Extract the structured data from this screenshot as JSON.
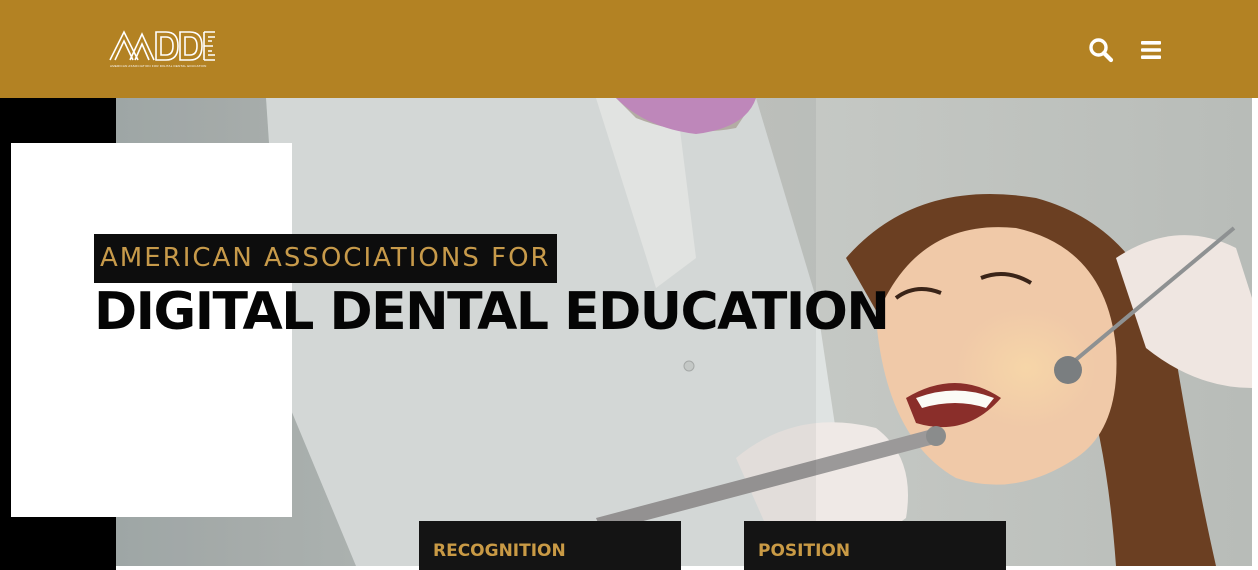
{
  "header": {
    "logo_text": "AADDE",
    "logo_tagline": "AMERICAN ASSOCIATION FOR DIGITAL DENTAL EDUCATION",
    "search_icon": "search-icon",
    "menu_icon": "hamburger-menu-icon",
    "background_color": "#b38223"
  },
  "hero": {
    "kicker": "AMERICAN ASSOCIATIONS FOR",
    "headline": "DIGITAL DENTAL EDUCATION",
    "image": "dental-patient-photo"
  },
  "cards": [
    {
      "label": "RECOGNITION"
    },
    {
      "label": "POSITION"
    }
  ],
  "colors": {
    "accent": "#c79a4a",
    "dark": "#141414"
  }
}
